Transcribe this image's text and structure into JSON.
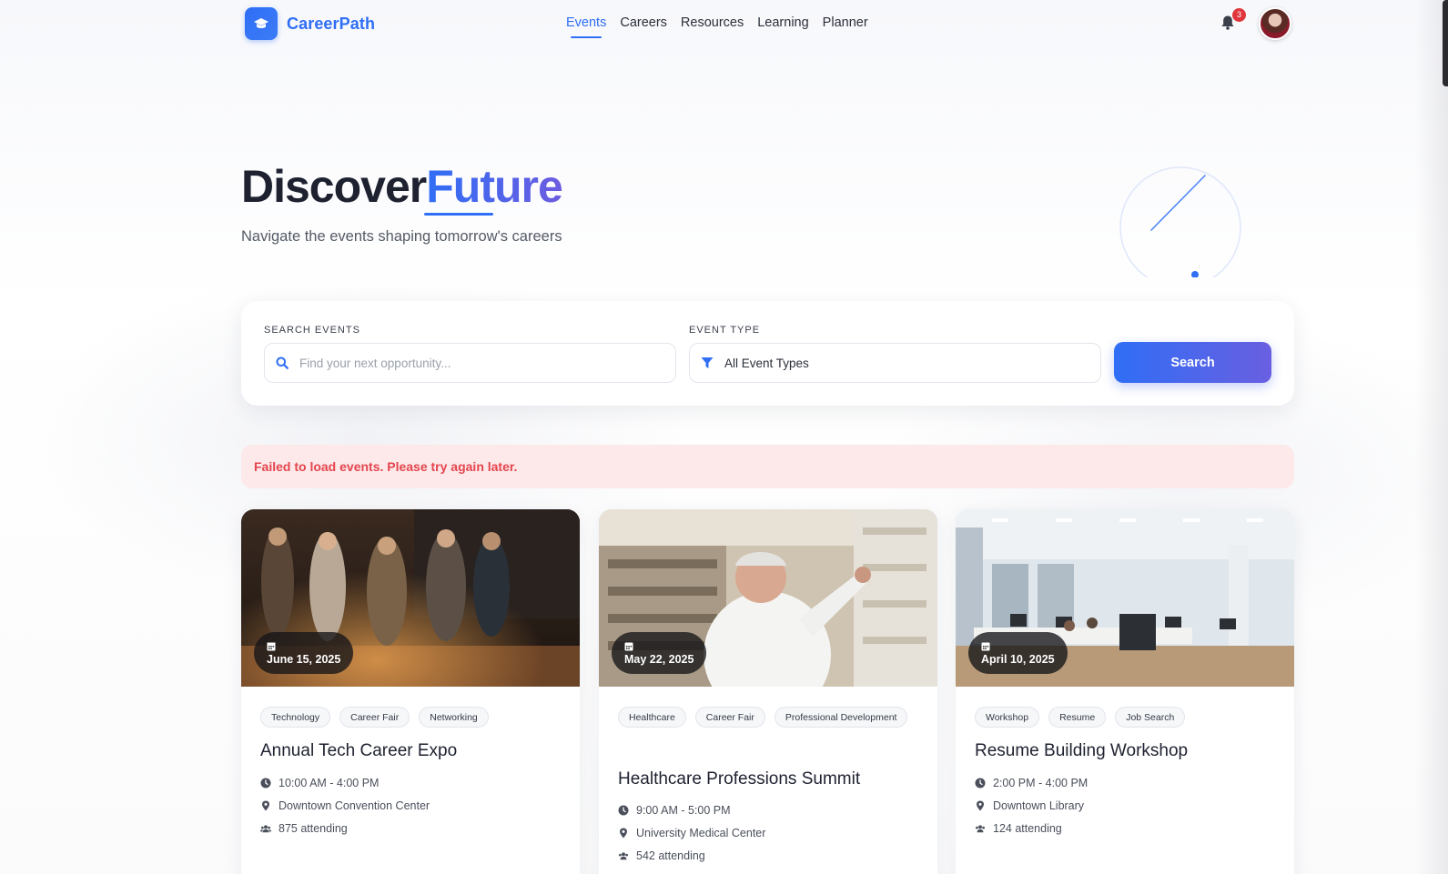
{
  "brand": {
    "name": "CareerPath",
    "icon": "graduation-cap-icon",
    "color": "#2f6ef5"
  },
  "nav": {
    "links": [
      {
        "label": "Events",
        "active": true
      },
      {
        "label": "Careers",
        "active": false
      },
      {
        "label": "Resources",
        "active": false
      },
      {
        "label": "Learning",
        "active": false
      },
      {
        "label": "Planner",
        "active": false
      }
    ],
    "notifications_count": "3"
  },
  "hero": {
    "title_main": "Discover",
    "title_accent": "Future",
    "subtitle": "Navigate the events shaping tomorrow's careers"
  },
  "search": {
    "search_label": "SEARCH EVENTS",
    "search_placeholder": "Find your next opportunity...",
    "search_value": "",
    "type_label": "EVENT TYPE",
    "type_value": "All Event Types",
    "button_label": "Search"
  },
  "error": {
    "message": "Failed to load events. Please try again later."
  },
  "events": [
    {
      "date": "June 15, 2025",
      "tags": [
        "Technology",
        "Career Fair",
        "Networking"
      ],
      "title": "Annual Tech Career Expo",
      "time": "10:00 AM - 4:00 PM",
      "location": "Downtown Convention Center",
      "attending": "875 attending"
    },
    {
      "date": "May 22, 2025",
      "tags": [
        "Healthcare",
        "Career Fair",
        "Professional Development"
      ],
      "title": "Healthcare Professions Summit",
      "time": "9:00 AM - 5:00 PM",
      "location": "University Medical Center",
      "attending": "542 attending"
    },
    {
      "date": "April 10, 2025",
      "tags": [
        "Workshop",
        "Resume",
        "Job Search"
      ],
      "title": "Resume Building Workshop",
      "time": "2:00 PM - 4:00 PM",
      "location": "Downtown Library",
      "attending": "124 attending"
    }
  ]
}
